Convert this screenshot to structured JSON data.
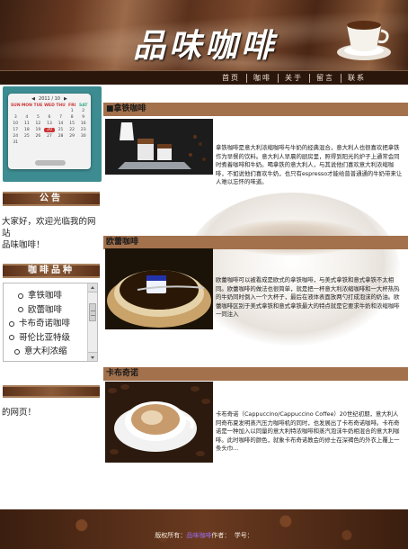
{
  "header": {
    "site_title": "品味咖啡",
    "nav": [
      "首页",
      "咖啡",
      "关于",
      "留言",
      "联系"
    ]
  },
  "sidebar": {
    "calendar": {
      "year_month": "2011 / 10",
      "weekdays": [
        "SUN",
        "MON",
        "TUE",
        "WED",
        "THU",
        "FRI",
        "SAT"
      ],
      "days": [
        "",
        "",
        "",
        "",
        "",
        "1",
        "2",
        "3",
        "4",
        "5",
        "6",
        "7",
        "8",
        "9",
        "10",
        "11",
        "12",
        "13",
        "14",
        "15",
        "16",
        "17",
        "18",
        "19",
        "20",
        "21",
        "22",
        "23",
        "24",
        "25",
        "26",
        "27",
        "28",
        "29",
        "30",
        "31"
      ],
      "today": "20"
    },
    "notice_title": "公告",
    "notice_text": "大家好，欢迎光临我的网站",
    "notice_text2": "品味咖啡！",
    "menu_title": "咖啡品种",
    "menu_items": [
      "拿铁咖啡",
      "欧蕾咖啡",
      "卡布奇诺咖啡",
      "哥伦比亚特级",
      "意大利浓缩"
    ],
    "guestbook_text": "的网页！"
  },
  "main": {
    "items": [
      {
        "title": "拿铁咖啡",
        "text": "拿铁咖啡是意大利浓缩咖啡与牛奶的经典混合，意大利人也很喜欢把拿铁作为早餐的饮料。意大利人早晨的厨房里，照得到阳光的炉子上通常会同时煮着咖啡和牛奶。喝拿铁的意大利人，与其说他们喜欢意大利浓缩咖啡，不如说他们喜欢牛奶，也只有espresso才能给普普通通的牛奶带来让人难以忘怀的味道。"
      },
      {
        "title": "欧蕾咖啡",
        "text": "欧蕾咖啡可以被看成是欧式的拿铁咖啡，与美式拿铁和意式拿铁不太相同。欧蕾咖啡的做法也很简单，就是把一杯意大利浓缩咖啡和一大杯热热的牛奶同时倒入一个大杯子，最后在液体表面放两勺打成泡沫的奶油。欧蕾咖啡区别于美式拿铁和意式拿铁最大的特点就是它要求牛奶和浓缩咖啡一同注入"
      },
      {
        "title": "卡布奇诺",
        "text": "卡布奇诺（Cappuccino/Cappuccino Coffee）20世纪初期，意大利人阿奇布夏发明蒸汽压力咖啡机的同时，也发展出了卡布奇诺咖啡。卡布奇诺是一种加入以同量的意大利特浓咖啡和蒸汽泡沫牛奶相混合的意大利咖啡。此时咖啡的颜色，就象卡布奇诺教会的修士在深褐色的外衣上覆上一条头巾..."
      }
    ]
  },
  "footer": {
    "prefix": "版权所有：",
    "link": "品味咖啡",
    "author": "作者：",
    "student_id": "学号："
  }
}
